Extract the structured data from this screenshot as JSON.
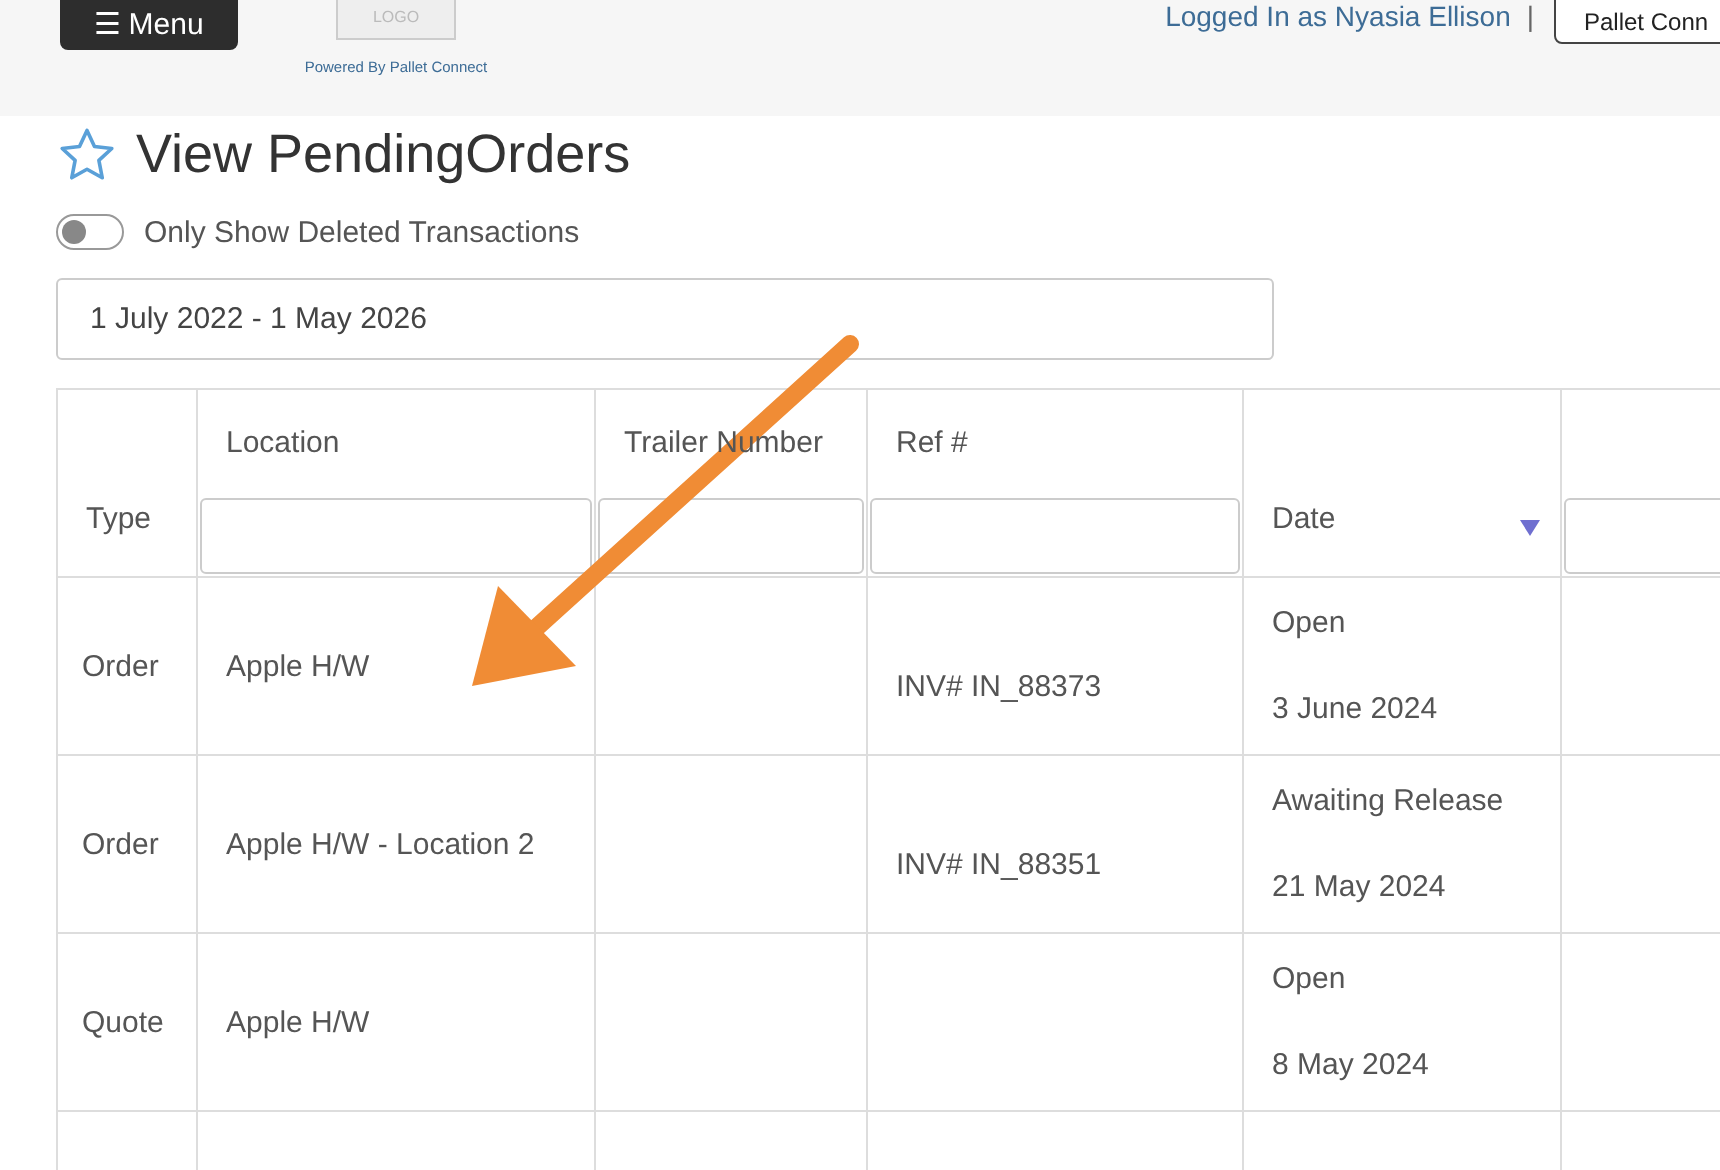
{
  "header": {
    "menu_button": "☰ Menu",
    "logo_text": "LOGO",
    "powered_by": "Powered By Pallet Connect",
    "user": "Logged In as Nyasia Ellison",
    "separator": "|",
    "account_button": "Pallet Conn"
  },
  "page": {
    "title": "View PendingOrders",
    "favorite": false
  },
  "deleted_toggle": {
    "label": "Only Show Deleted Transactions",
    "on": false
  },
  "date_range": {
    "value": "1 July 2022 - 1 May 2026"
  },
  "table": {
    "columns": [
      {
        "label": "Type",
        "kind": "plain",
        "sorted": false
      },
      {
        "label": "Location",
        "kind": "filter",
        "sorted": false
      },
      {
        "label": "Trailer Number",
        "kind": "filter",
        "sorted": false
      },
      {
        "label": "Ref #",
        "kind": "filter",
        "sorted": false
      },
      {
        "label": "Date",
        "kind": "plain",
        "sorted": true
      },
      {
        "kind": "filter",
        "sorted": false
      }
    ],
    "rows": [
      {
        "type": "Order",
        "location": "Apple H/W",
        "ref": "INV# IN_88373",
        "status": "Open",
        "date": "3 June 2024"
      },
      {
        "type": "Order",
        "location": "Apple H/W - Location 2",
        "ref": "INV# IN_88351",
        "status": "Awaiting Release",
        "date": "21 May 2024"
      },
      {
        "type": "Quote",
        "location": "Apple H/W",
        "status": "Open",
        "date": "8 May 2024"
      }
    ]
  },
  "annotation": {
    "kind": "arrow"
  }
}
